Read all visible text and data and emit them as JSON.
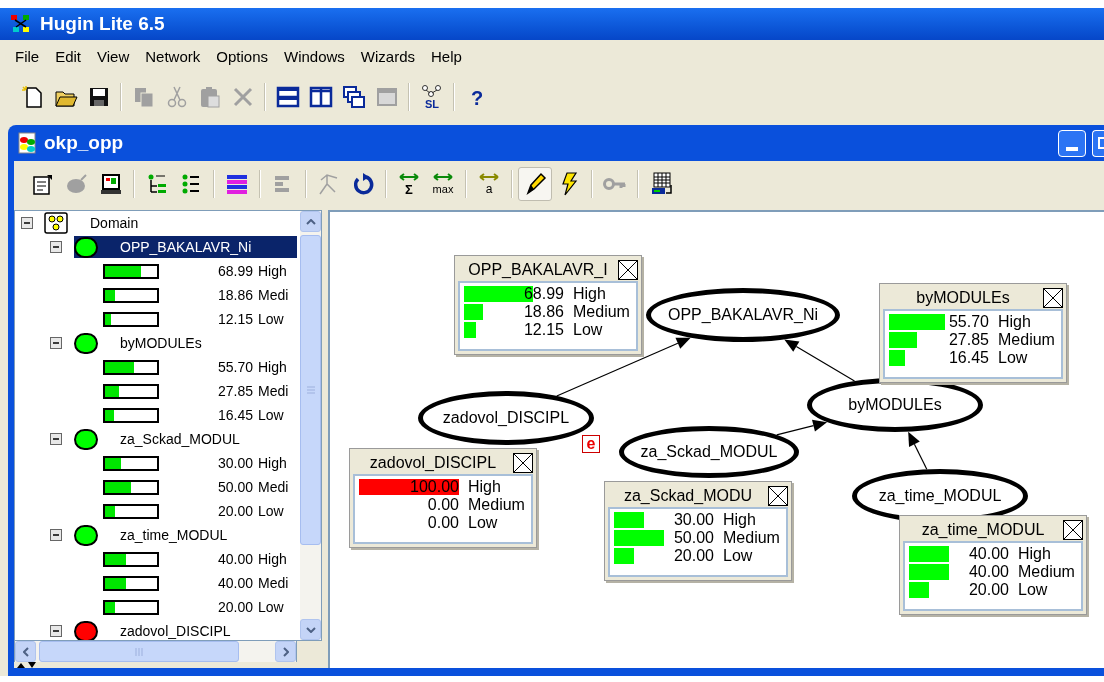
{
  "window": {
    "title": "Hugin Lite 6.5"
  },
  "menu": [
    "File",
    "Edit",
    "View",
    "Network",
    "Options",
    "Windows",
    "Wizards",
    "Help"
  ],
  "main_toolbar": [
    {
      "kind": "new",
      "disabled": false
    },
    {
      "kind": "open",
      "disabled": false
    },
    {
      "kind": "save",
      "disabled": false
    },
    {
      "kind": "separator"
    },
    {
      "kind": "copy",
      "disabled": true
    },
    {
      "kind": "cut",
      "disabled": true
    },
    {
      "kind": "paste",
      "disabled": true
    },
    {
      "kind": "delete",
      "disabled": true
    },
    {
      "kind": "separator"
    },
    {
      "kind": "tile-h",
      "disabled": false
    },
    {
      "kind": "tile-v",
      "disabled": false
    },
    {
      "kind": "cascade",
      "disabled": false
    },
    {
      "kind": "window",
      "disabled": true
    },
    {
      "kind": "separator"
    },
    {
      "kind": "graph",
      "disabled": false,
      "label": "SL"
    },
    {
      "kind": "separator"
    },
    {
      "kind": "help",
      "disabled": false,
      "label": "?"
    }
  ],
  "document": {
    "title": "okp_opp",
    "toolbar": [
      {
        "kind": "properties",
        "disabled": false,
        "pressed": false
      },
      {
        "kind": "oval",
        "disabled": true,
        "pressed": false
      },
      {
        "kind": "monitor",
        "disabled": false,
        "pressed": false
      },
      {
        "kind": "separator"
      },
      {
        "kind": "node-list",
        "disabled": false,
        "pressed": false
      },
      {
        "kind": "node-grid",
        "disabled": false,
        "pressed": false
      },
      {
        "kind": "separator"
      },
      {
        "kind": "stripes",
        "disabled": false,
        "pressed": false
      },
      {
        "kind": "separator"
      },
      {
        "kind": "bars",
        "disabled": true,
        "pressed": false
      },
      {
        "kind": "separator"
      },
      {
        "kind": "branch",
        "disabled": true,
        "pressed": false
      },
      {
        "kind": "reload",
        "disabled": false,
        "pressed": false
      },
      {
        "kind": "separator"
      },
      {
        "kind": "sum",
        "disabled": false,
        "pressed": false,
        "label": "Σ"
      },
      {
        "kind": "max",
        "disabled": false,
        "pressed": false,
        "label": "max"
      },
      {
        "kind": "separator"
      },
      {
        "kind": "text-arrows",
        "disabled": false,
        "pressed": false,
        "label": "a"
      },
      {
        "kind": "separator"
      },
      {
        "kind": "pencil",
        "disabled": false,
        "pressed": true
      },
      {
        "kind": "lightning",
        "disabled": false,
        "pressed": false
      },
      {
        "kind": "separator"
      },
      {
        "kind": "key",
        "disabled": true,
        "pressed": false
      },
      {
        "kind": "separator"
      },
      {
        "kind": "table",
        "disabled": false,
        "pressed": false
      }
    ],
    "tree": {
      "root": {
        "label": "Domain",
        "expanded": true,
        "children": [
          {
            "label": "OPP_BAKALAVR_Ni",
            "color": "#00ff00",
            "expanded": true,
            "selected": true,
            "states": [
              {
                "probability": "68.99",
                "state": "High",
                "level": 0.6899
              },
              {
                "probability": "18.86",
                "state": "Medi",
                "level": 0.1886
              },
              {
                "probability": "12.15",
                "state": "Low",
                "level": 0.1215
              }
            ]
          },
          {
            "label": "byMODULEs",
            "color": "#00ff00",
            "expanded": true,
            "selected": false,
            "states": [
              {
                "probability": "55.70",
                "state": "High",
                "level": 0.557
              },
              {
                "probability": "27.85",
                "state": "Medi",
                "level": 0.2785
              },
              {
                "probability": "16.45",
                "state": "Low",
                "level": 0.1645
              }
            ]
          },
          {
            "label": "za_Sckad_MODUL",
            "color": "#00ff00",
            "expanded": true,
            "selected": false,
            "states": [
              {
                "probability": "30.00",
                "state": "High",
                "level": 0.3
              },
              {
                "probability": "50.00",
                "state": "Medi",
                "level": 0.5
              },
              {
                "probability": "20.00",
                "state": "Low",
                "level": 0.2
              }
            ]
          },
          {
            "label": "za_time_MODUL",
            "color": "#00ff00",
            "expanded": true,
            "selected": false,
            "states": [
              {
                "probability": "40.00",
                "state": "High",
                "level": 0.4
              },
              {
                "probability": "40.00",
                "state": "Medi",
                "level": 0.4
              },
              {
                "probability": "20.00",
                "state": "Low",
                "level": 0.2
              }
            ]
          },
          {
            "label": "zadovol_DISCIPL",
            "color": "#ff0000",
            "expanded": true,
            "selected": false
          }
        ]
      }
    },
    "network": {
      "nodes": [
        {
          "label": "OPP_BAKALAVR_Ni",
          "monitor": {
            "title": "OPP_BAKALAVR_I",
            "evidence": false,
            "states": [
              {
                "probability": "68.99",
                "state": "High",
                "level": 0.6899
              },
              {
                "probability": "18.86",
                "state": "Medium",
                "level": 0.1886
              },
              {
                "probability": "12.15",
                "state": "Low",
                "level": 0.1215
              }
            ]
          }
        },
        {
          "label": "byMODULEs",
          "monitor": {
            "title": "byMODULEs",
            "evidence": false,
            "states": [
              {
                "probability": "55.70",
                "state": "High",
                "level": 0.557
              },
              {
                "probability": "27.85",
                "state": "Medium",
                "level": 0.2785
              },
              {
                "probability": "16.45",
                "state": "Low",
                "level": 0.1645
              }
            ]
          }
        },
        {
          "label": "zadovol_DISCIPL",
          "badge": "e",
          "monitor": {
            "title": "zadovol_DISCIPL",
            "evidence": true,
            "states": [
              {
                "probability": "100.00",
                "state": "High",
                "level": 1
              },
              {
                "probability": "0.00",
                "state": "Medium",
                "level": 0
              },
              {
                "probability": "0.00",
                "state": "Low",
                "level": 0
              }
            ]
          }
        },
        {
          "label": "za_Sckad_MODUL",
          "monitor": {
            "title": "za_Sckad_MODU",
            "evidence": false,
            "states": [
              {
                "probability": "30.00",
                "state": "High",
                "level": 0.3
              },
              {
                "probability": "50.00",
                "state": "Medium",
                "level": 0.5
              },
              {
                "probability": "20.00",
                "state": "Low",
                "level": 0.2
              }
            ]
          }
        },
        {
          "label": "za_time_MODUL",
          "monitor": {
            "title": "za_time_MODUL",
            "evidence": false,
            "states": [
              {
                "probability": "40.00",
                "state": "High",
                "level": 0.4
              },
              {
                "probability": "40.00",
                "state": "Medium",
                "level": 0.4
              },
              {
                "probability": "20.00",
                "state": "Low",
                "level": 0.2
              }
            ]
          }
        }
      ]
    }
  }
}
